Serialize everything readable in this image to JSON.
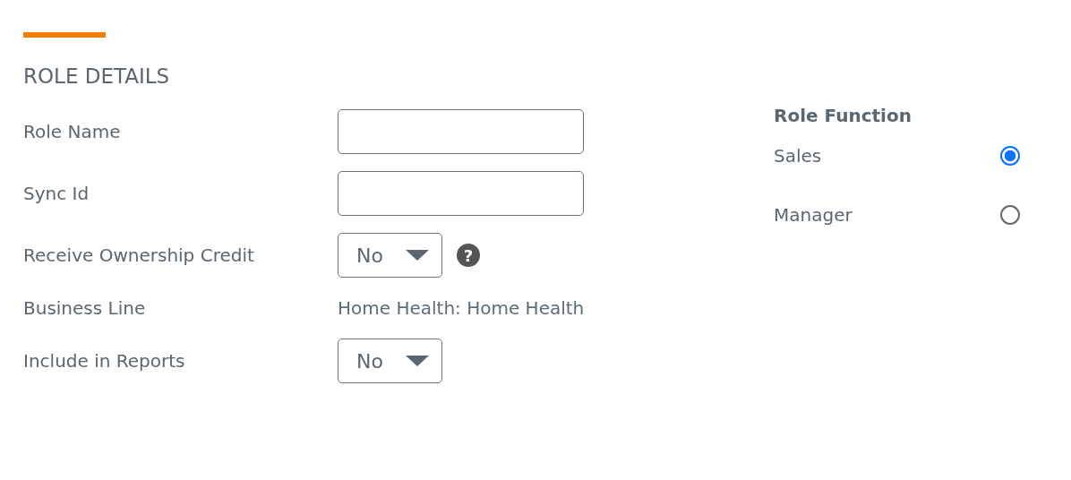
{
  "section": {
    "title": "ROLE DETAILS"
  },
  "fields": [
    {
      "label": "Role Name",
      "kind": "text"
    },
    {
      "label": "Sync Id",
      "kind": "text"
    },
    {
      "label": "Receive Ownership Credit",
      "kind": "select",
      "value": "No",
      "help": "?"
    },
    {
      "label": "Business Line",
      "kind": "static",
      "value": "Home Health: Home Health"
    },
    {
      "label": "Include in Reports",
      "kind": "select",
      "value": "No"
    }
  ],
  "role_function": {
    "title": "Role Function",
    "options": [
      {
        "label": "Sales",
        "selected": true
      },
      {
        "label": "Manager",
        "selected": false
      }
    ]
  }
}
